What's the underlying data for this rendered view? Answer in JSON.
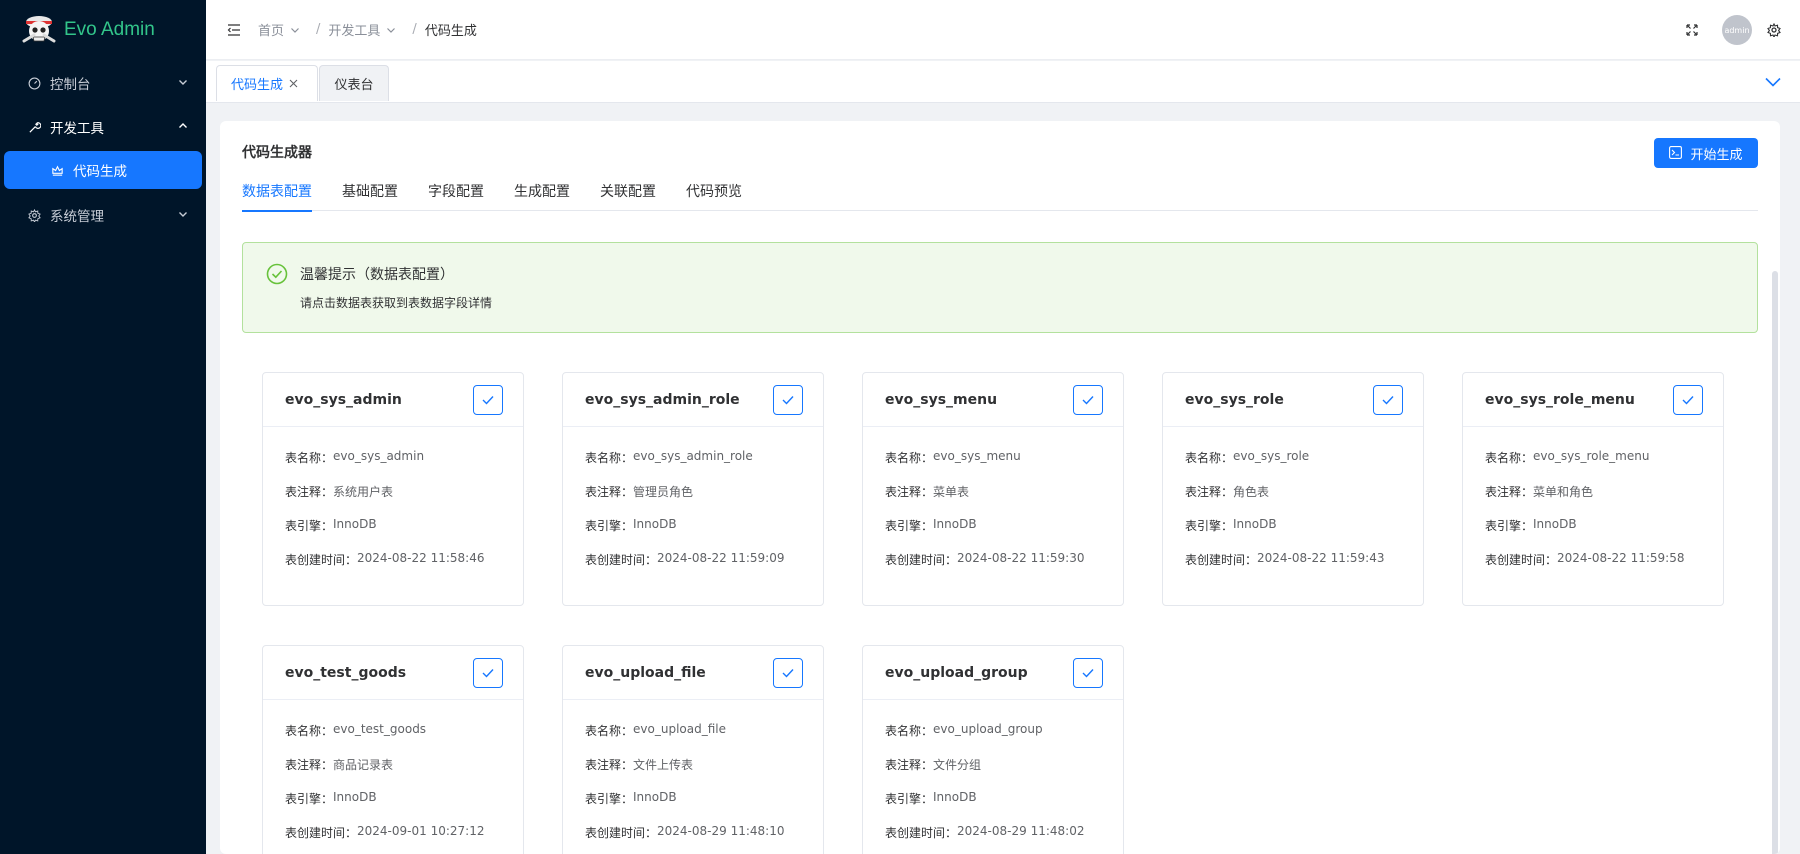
{
  "app": {
    "name": "Evo Admin"
  },
  "sidebar": {
    "items": [
      {
        "label": "控制台",
        "icon": "dashboard-icon",
        "expanded": false
      },
      {
        "label": "开发工具",
        "icon": "tool-icon",
        "expanded": true,
        "children": [
          {
            "label": "代码生成",
            "icon": "code-gen-icon",
            "active": true
          }
        ]
      },
      {
        "label": "系统管理",
        "icon": "gear-icon",
        "expanded": false
      }
    ]
  },
  "header": {
    "breadcrumb": [
      {
        "label": "首页"
      },
      {
        "label": "开发工具"
      },
      {
        "label": "代码生成"
      }
    ],
    "avatar_text": "admin"
  },
  "tabs": [
    {
      "label": "代码生成",
      "active": true,
      "closable": true
    },
    {
      "label": "仪表台",
      "active": false
    }
  ],
  "main": {
    "title": "代码生成器",
    "generate_button": "开始生成",
    "subtabs": [
      "数据表配置",
      "基础配置",
      "字段配置",
      "生成配置",
      "关联配置",
      "代码预览"
    ],
    "alert": {
      "title": "温馨提示（数据表配置）",
      "description": "请点击数据表获取到表数据字段详情"
    },
    "field_labels": {
      "name": "表名称：",
      "comment": "表注释：",
      "engine": "表引擎：",
      "created": "表创建时间："
    },
    "tables": [
      {
        "name": "evo_sys_admin",
        "comment": "系统用户表",
        "engine": "InnoDB",
        "created": "2024-08-22 11:58:46",
        "checked": true
      },
      {
        "name": "evo_sys_admin_role",
        "comment": "管理员角色",
        "engine": "InnoDB",
        "created": "2024-08-22 11:59:09",
        "checked": true
      },
      {
        "name": "evo_sys_menu",
        "comment": "菜单表",
        "engine": "InnoDB",
        "created": "2024-08-22 11:59:30",
        "checked": true
      },
      {
        "name": "evo_sys_role",
        "comment": "角色表",
        "engine": "InnoDB",
        "created": "2024-08-22 11:59:43",
        "checked": true
      },
      {
        "name": "evo_sys_role_menu",
        "comment": "菜单和角色",
        "engine": "InnoDB",
        "created": "2024-08-22 11:59:58",
        "checked": true
      },
      {
        "name": "evo_test_goods",
        "comment": "商品记录表",
        "engine": "InnoDB",
        "created": "2024-09-01 10:27:12",
        "checked": true
      },
      {
        "name": "evo_upload_file",
        "comment": "文件上传表",
        "engine": "InnoDB",
        "created": "2024-08-29 11:48:10",
        "checked": true
      },
      {
        "name": "evo_upload_group",
        "comment": "文件分组",
        "engine": "InnoDB",
        "created": "2024-08-29 11:48:02",
        "checked": true
      }
    ]
  },
  "colors": {
    "primary": "#1677ff",
    "sidebar_bg": "#001529",
    "logo_text": "#32c58a",
    "success_bg": "#f0f9eb",
    "success_border": "#b3e19d",
    "success_icon": "#67c23a"
  }
}
